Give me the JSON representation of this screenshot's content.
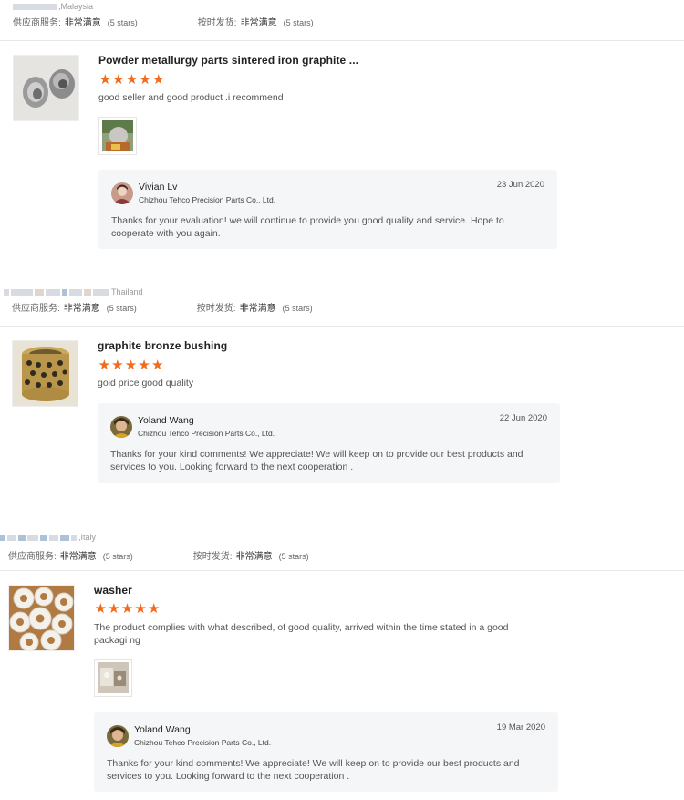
{
  "labels": {
    "supplier_service": "供应商服务:",
    "on_time_shipping": "按时发货:",
    "very_satisfied": "非常满意",
    "five_stars": "(5 stars)",
    "star_glyph": "★"
  },
  "reviews": [
    {
      "buyer_country": "Malaysia",
      "product_title": "Powder metallurgy parts sintered iron graphite ...",
      "rating": 5,
      "comment": "good seller and good product .i recommend",
      "has_photo": true,
      "reply": {
        "name": "Vivian Lv",
        "company": "Chizhou Tehco Precision Parts Co., Ltd.",
        "date": "23 Jun 2020",
        "text": "Thanks for your evaluation! we will continue to provide you good quality and service. Hope to cooperate with you again."
      }
    },
    {
      "buyer_country": "Thailand",
      "product_title": "graphite bronze bushing",
      "rating": 5,
      "comment": "goid price good quality",
      "has_photo": false,
      "reply": {
        "name": "Yoland Wang",
        "company": "Chizhou Tehco Precision Parts Co., Ltd.",
        "date": "22 Jun 2020",
        "text": "Thanks for your kind comments! We appreciate!  We will keep on to provide our best products and services to you. Looking forward to the next cooperation ."
      }
    },
    {
      "buyer_country": "Italy",
      "product_title": "washer",
      "rating": 5,
      "comment": "The product complies with what described, of good quality, arrived within the time stated in a good packagi ng",
      "has_photo": true,
      "reply": {
        "name": "Yoland Wang",
        "company": "Chizhou Tehco Precision Parts Co., Ltd.",
        "date": "19 Mar 2020",
        "text": "Thanks for your kind comments! We appreciate!  We will keep on to provide our best products and services to you. Looking forward to the next cooperation ."
      }
    }
  ],
  "colors": {
    "star": "#f26a1b",
    "reply_bg": "#f5f6f8",
    "divider": "#e8e8e8"
  }
}
